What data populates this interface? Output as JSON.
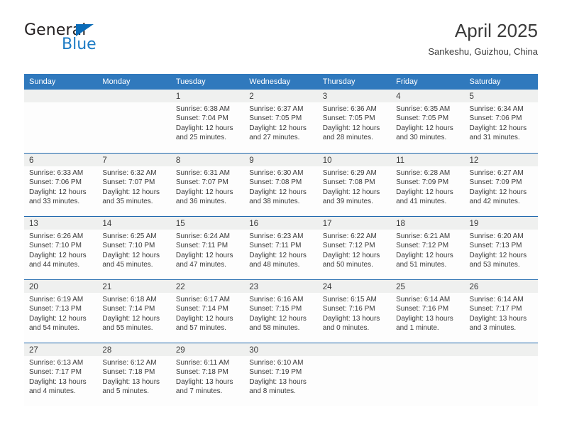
{
  "logo": {
    "word_one": "General",
    "word_two": "Blue",
    "triangle_icon": "blue-triangle-icon",
    "colors": {
      "general": "#231f20",
      "blue": "#1b7ac4",
      "triangle": "#0b6cb8"
    }
  },
  "header": {
    "title": "April 2025",
    "subtitle": "Sankeshu, Guizhou, China"
  },
  "colors": {
    "header_band": "#3079bd",
    "week_divider": "#1f68ad",
    "date_band": "#eff0ef",
    "cell_background": "#fdfdfd",
    "text": "#3a3a3a"
  },
  "weekdays": [
    "Sunday",
    "Monday",
    "Tuesday",
    "Wednesday",
    "Thursday",
    "Friday",
    "Saturday"
  ],
  "weeks": [
    [
      {
        "day": "",
        "blank": true,
        "sunrise": "",
        "sunset": "",
        "daylight1": "",
        "daylight2": ""
      },
      {
        "day": "",
        "blank": true,
        "sunrise": "",
        "sunset": "",
        "daylight1": "",
        "daylight2": ""
      },
      {
        "day": "1",
        "blank": false,
        "sunrise": "Sunrise: 6:38 AM",
        "sunset": "Sunset: 7:04 PM",
        "daylight1": "Daylight: 12 hours",
        "daylight2": "and 25 minutes."
      },
      {
        "day": "2",
        "blank": false,
        "sunrise": "Sunrise: 6:37 AM",
        "sunset": "Sunset: 7:05 PM",
        "daylight1": "Daylight: 12 hours",
        "daylight2": "and 27 minutes."
      },
      {
        "day": "3",
        "blank": false,
        "sunrise": "Sunrise: 6:36 AM",
        "sunset": "Sunset: 7:05 PM",
        "daylight1": "Daylight: 12 hours",
        "daylight2": "and 28 minutes."
      },
      {
        "day": "4",
        "blank": false,
        "sunrise": "Sunrise: 6:35 AM",
        "sunset": "Sunset: 7:05 PM",
        "daylight1": "Daylight: 12 hours",
        "daylight2": "and 30 minutes."
      },
      {
        "day": "5",
        "blank": false,
        "sunrise": "Sunrise: 6:34 AM",
        "sunset": "Sunset: 7:06 PM",
        "daylight1": "Daylight: 12 hours",
        "daylight2": "and 31 minutes."
      }
    ],
    [
      {
        "day": "6",
        "blank": false,
        "sunrise": "Sunrise: 6:33 AM",
        "sunset": "Sunset: 7:06 PM",
        "daylight1": "Daylight: 12 hours",
        "daylight2": "and 33 minutes."
      },
      {
        "day": "7",
        "blank": false,
        "sunrise": "Sunrise: 6:32 AM",
        "sunset": "Sunset: 7:07 PM",
        "daylight1": "Daylight: 12 hours",
        "daylight2": "and 35 minutes."
      },
      {
        "day": "8",
        "blank": false,
        "sunrise": "Sunrise: 6:31 AM",
        "sunset": "Sunset: 7:07 PM",
        "daylight1": "Daylight: 12 hours",
        "daylight2": "and 36 minutes."
      },
      {
        "day": "9",
        "blank": false,
        "sunrise": "Sunrise: 6:30 AM",
        "sunset": "Sunset: 7:08 PM",
        "daylight1": "Daylight: 12 hours",
        "daylight2": "and 38 minutes."
      },
      {
        "day": "10",
        "blank": false,
        "sunrise": "Sunrise: 6:29 AM",
        "sunset": "Sunset: 7:08 PM",
        "daylight1": "Daylight: 12 hours",
        "daylight2": "and 39 minutes."
      },
      {
        "day": "11",
        "blank": false,
        "sunrise": "Sunrise: 6:28 AM",
        "sunset": "Sunset: 7:09 PM",
        "daylight1": "Daylight: 12 hours",
        "daylight2": "and 41 minutes."
      },
      {
        "day": "12",
        "blank": false,
        "sunrise": "Sunrise: 6:27 AM",
        "sunset": "Sunset: 7:09 PM",
        "daylight1": "Daylight: 12 hours",
        "daylight2": "and 42 minutes."
      }
    ],
    [
      {
        "day": "13",
        "blank": false,
        "sunrise": "Sunrise: 6:26 AM",
        "sunset": "Sunset: 7:10 PM",
        "daylight1": "Daylight: 12 hours",
        "daylight2": "and 44 minutes."
      },
      {
        "day": "14",
        "blank": false,
        "sunrise": "Sunrise: 6:25 AM",
        "sunset": "Sunset: 7:10 PM",
        "daylight1": "Daylight: 12 hours",
        "daylight2": "and 45 minutes."
      },
      {
        "day": "15",
        "blank": false,
        "sunrise": "Sunrise: 6:24 AM",
        "sunset": "Sunset: 7:11 PM",
        "daylight1": "Daylight: 12 hours",
        "daylight2": "and 47 minutes."
      },
      {
        "day": "16",
        "blank": false,
        "sunrise": "Sunrise: 6:23 AM",
        "sunset": "Sunset: 7:11 PM",
        "daylight1": "Daylight: 12 hours",
        "daylight2": "and 48 minutes."
      },
      {
        "day": "17",
        "blank": false,
        "sunrise": "Sunrise: 6:22 AM",
        "sunset": "Sunset: 7:12 PM",
        "daylight1": "Daylight: 12 hours",
        "daylight2": "and 50 minutes."
      },
      {
        "day": "18",
        "blank": false,
        "sunrise": "Sunrise: 6:21 AM",
        "sunset": "Sunset: 7:12 PM",
        "daylight1": "Daylight: 12 hours",
        "daylight2": "and 51 minutes."
      },
      {
        "day": "19",
        "blank": false,
        "sunrise": "Sunrise: 6:20 AM",
        "sunset": "Sunset: 7:13 PM",
        "daylight1": "Daylight: 12 hours",
        "daylight2": "and 53 minutes."
      }
    ],
    [
      {
        "day": "20",
        "blank": false,
        "sunrise": "Sunrise: 6:19 AM",
        "sunset": "Sunset: 7:13 PM",
        "daylight1": "Daylight: 12 hours",
        "daylight2": "and 54 minutes."
      },
      {
        "day": "21",
        "blank": false,
        "sunrise": "Sunrise: 6:18 AM",
        "sunset": "Sunset: 7:14 PM",
        "daylight1": "Daylight: 12 hours",
        "daylight2": "and 55 minutes."
      },
      {
        "day": "22",
        "blank": false,
        "sunrise": "Sunrise: 6:17 AM",
        "sunset": "Sunset: 7:14 PM",
        "daylight1": "Daylight: 12 hours",
        "daylight2": "and 57 minutes."
      },
      {
        "day": "23",
        "blank": false,
        "sunrise": "Sunrise: 6:16 AM",
        "sunset": "Sunset: 7:15 PM",
        "daylight1": "Daylight: 12 hours",
        "daylight2": "and 58 minutes."
      },
      {
        "day": "24",
        "blank": false,
        "sunrise": "Sunrise: 6:15 AM",
        "sunset": "Sunset: 7:16 PM",
        "daylight1": "Daylight: 13 hours",
        "daylight2": "and 0 minutes."
      },
      {
        "day": "25",
        "blank": false,
        "sunrise": "Sunrise: 6:14 AM",
        "sunset": "Sunset: 7:16 PM",
        "daylight1": "Daylight: 13 hours",
        "daylight2": "and 1 minute."
      },
      {
        "day": "26",
        "blank": false,
        "sunrise": "Sunrise: 6:14 AM",
        "sunset": "Sunset: 7:17 PM",
        "daylight1": "Daylight: 13 hours",
        "daylight2": "and 3 minutes."
      }
    ],
    [
      {
        "day": "27",
        "blank": false,
        "sunrise": "Sunrise: 6:13 AM",
        "sunset": "Sunset: 7:17 PM",
        "daylight1": "Daylight: 13 hours",
        "daylight2": "and 4 minutes."
      },
      {
        "day": "28",
        "blank": false,
        "sunrise": "Sunrise: 6:12 AM",
        "sunset": "Sunset: 7:18 PM",
        "daylight1": "Daylight: 13 hours",
        "daylight2": "and 5 minutes."
      },
      {
        "day": "29",
        "blank": false,
        "sunrise": "Sunrise: 6:11 AM",
        "sunset": "Sunset: 7:18 PM",
        "daylight1": "Daylight: 13 hours",
        "daylight2": "and 7 minutes."
      },
      {
        "day": "30",
        "blank": false,
        "sunrise": "Sunrise: 6:10 AM",
        "sunset": "Sunset: 7:19 PM",
        "daylight1": "Daylight: 13 hours",
        "daylight2": "and 8 minutes."
      },
      {
        "day": "",
        "blank": true,
        "sunrise": "",
        "sunset": "",
        "daylight1": "",
        "daylight2": ""
      },
      {
        "day": "",
        "blank": true,
        "sunrise": "",
        "sunset": "",
        "daylight1": "",
        "daylight2": ""
      },
      {
        "day": "",
        "blank": true,
        "sunrise": "",
        "sunset": "",
        "daylight1": "",
        "daylight2": ""
      }
    ]
  ]
}
